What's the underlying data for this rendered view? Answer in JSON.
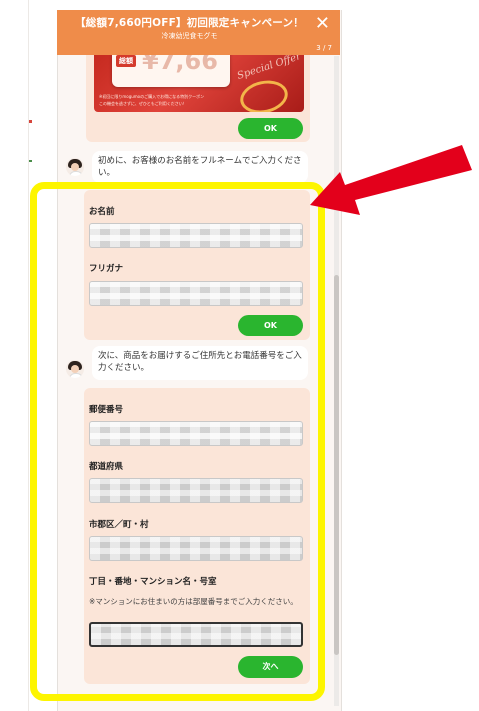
{
  "header": {
    "title": "【総額7,660円OFF】初回限定キャンペーン！",
    "subtitle": "冷凍幼児食モグモ",
    "close_glyph": "✕",
    "step_counter": "3 / 7"
  },
  "banner": {
    "badge_label": "総額",
    "amount_text": "¥7,66",
    "note": "※初回に限りmogumoのご購入でお得になる特別クーポンこの機会を逃さずに、ぜひともご利用ください！",
    "script_text": "Special Offer"
  },
  "buttons": {
    "ok_label": "OK",
    "next_label": "次へ"
  },
  "messages": {
    "ask_name": "初めに、お客様のお名前をフルネームでご入力ください。",
    "ask_address": "次に、商品をお届けするご住所先とお電話番号をご入力ください。"
  },
  "form": {
    "name_label": "お名前",
    "name_value": "",
    "furigana_label": "フリガナ",
    "furigana_value": "",
    "postal_label": "郵便番号",
    "postal_value": "",
    "prefecture_label": "都道府県",
    "prefecture_value": "",
    "city_label": "市郡区／町・村",
    "city_value": "",
    "street_label": "丁目・番地・マンション名・号室",
    "street_hint": "※マンションにお住まいの方は部屋番号までご入力ください。",
    "street_value": ""
  },
  "annotation": {
    "highlight_color": "#fdf500",
    "arrow_color": "#e3001b"
  },
  "colors": {
    "header_bg": "#ef8c4a",
    "bubble_bg": "#fbe5d8",
    "button_green": "#2ab52f"
  }
}
